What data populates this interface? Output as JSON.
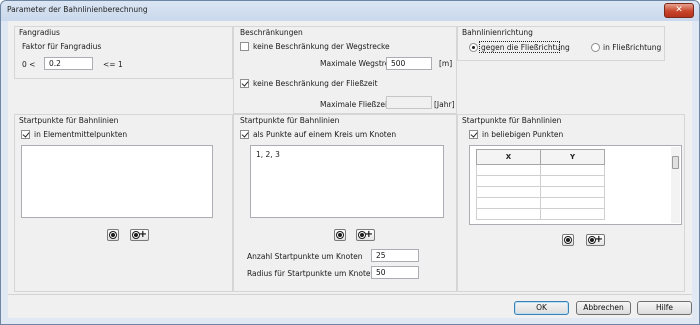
{
  "window": {
    "title": "Parameter der Bahnlinienberechnung",
    "close_glyph": "✕"
  },
  "fangradius": {
    "group_title": "Fangradius",
    "factor_label": "Faktor für Fangradius",
    "lower_bound": "0 <",
    "value": "0.2",
    "upper_bound": "<= 1"
  },
  "beschraenkungen": {
    "group_title": "Beschränkungen",
    "no_path_limit_label": "keine Beschränkung der Wegstrecke",
    "no_path_limit_checked": false,
    "max_path_label": "Maximale Wegstrecke",
    "max_path_value": "500",
    "max_path_unit": "[m]",
    "no_time_limit_label": "keine Beschränkung der Fließzeit",
    "no_time_limit_checked": true,
    "max_time_label": "Maximale Fließzeit",
    "max_time_value": "",
    "max_time_unit": "[Jahr]"
  },
  "richtung": {
    "group_title": "Bahnlinienrichtung",
    "option_against": "gegen die Fließrichtung",
    "option_with": "in Fließrichtung",
    "selected": "option_against"
  },
  "startpunkte_elements": {
    "group_title": "Startpunkte für Bahnlinien",
    "checkbox_label": "in Elementmittelpunkten",
    "checked": true,
    "list_text": ""
  },
  "startpunkte_circle": {
    "group_title": "Startpunkte für Bahnlinien",
    "checkbox_label": "als Punkte auf einem Kreis um Knoten",
    "checked": true,
    "list_text": "1, 2, 3",
    "count_label": "Anzahl Startpunkte um Knoten",
    "count_value": "25",
    "radius_label": "Radius für Startpunkte um Knoten",
    "radius_value": "50"
  },
  "startpunkte_arbitrary": {
    "group_title": "Startpunkte für Bahnlinien",
    "checkbox_label": "in beliebigen Punkten",
    "checked": true,
    "table_headers": [
      "X",
      "Y"
    ],
    "rows": [
      [
        "",
        ""
      ],
      [
        "",
        ""
      ],
      [
        "",
        ""
      ],
      [
        "",
        ""
      ],
      [
        "",
        ""
      ]
    ]
  },
  "footer": {
    "ok_label": "OK",
    "cancel_label": "Abbrechen",
    "help_label": "Hilfe"
  },
  "icons": {
    "select_points": "target-dot-icon",
    "add_points": "target-plus-icon",
    "plus_glyph": "+"
  }
}
